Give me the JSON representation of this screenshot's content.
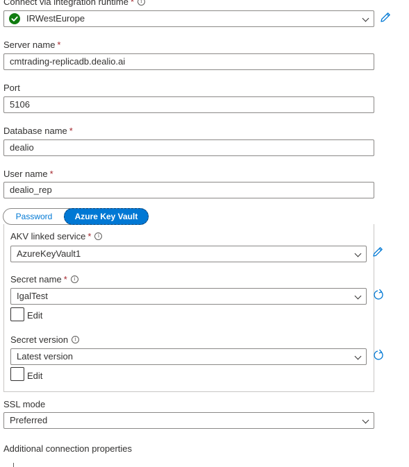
{
  "runtime": {
    "label": "Connect via integration runtime",
    "required": "*",
    "value": "IRWestEurope",
    "status_color": "#107c10"
  },
  "server_name": {
    "label": "Server name",
    "required": "*",
    "value": "cmtrading-replicadb.dealio.ai"
  },
  "port": {
    "label": "Port",
    "value": "5106"
  },
  "database_name": {
    "label": "Database name",
    "required": "*",
    "value": "dealio"
  },
  "user_name": {
    "label": "User name",
    "required": "*",
    "value": "dealio_rep"
  },
  "auth_toggle": {
    "password_label": "Password",
    "akv_label": "Azure Key Vault",
    "selected": "Azure Key Vault",
    "accent": "#0078d4"
  },
  "akv": {
    "linked_service": {
      "label": "AKV linked service",
      "required": "*",
      "value": "AzureKeyVault1"
    },
    "secret_name": {
      "label": "Secret name",
      "required": "*",
      "value": "IgalTest",
      "edit_label": "Edit"
    },
    "secret_version": {
      "label": "Secret version",
      "value": "Latest version",
      "edit_label": "Edit"
    }
  },
  "ssl_mode": {
    "label": "SSL mode",
    "value": "Preferred"
  },
  "additional_props": {
    "label": "Additional connection properties"
  },
  "icons": {
    "edit": "pencil-icon",
    "refresh": "refresh-icon",
    "info": "info-icon",
    "check": "check-circle-icon",
    "chevron": "chevron-down-icon"
  }
}
